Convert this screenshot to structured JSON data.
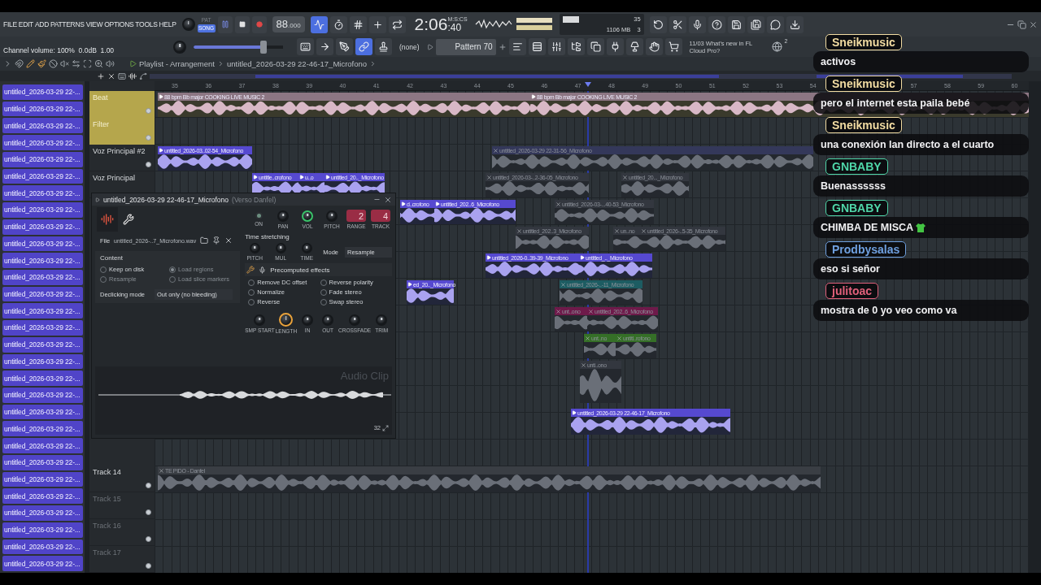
{
  "menu": [
    "FILE",
    "EDIT",
    "ADD",
    "PATTERNS",
    "VIEW",
    "OPTIONS",
    "TOOLS",
    "HELP"
  ],
  "hint_bar": "Channel volume: 100%  0.0dB  1.00",
  "mode_toggle": [
    {
      "label": "PAT",
      "selected": false
    },
    {
      "label": "SONG",
      "selected": true
    }
  ],
  "tempo": {
    "value": "88",
    "decimals": ".000"
  },
  "snap_toggles": [
    {
      "selected": true
    },
    {
      "selected": false
    },
    {
      "selected": false
    },
    {
      "selected": false
    },
    {
      "selected": false
    }
  ],
  "time": {
    "value": "2:06",
    "small": ":40",
    "unit": "M:S:CS"
  },
  "cpu": {
    "value": "35",
    "memory": "1106 MB",
    "polyphony": "3"
  },
  "master_slider": {
    "level": 0.82
  },
  "tool_toggles": [
    {
      "selected": false
    },
    {
      "selected": false
    },
    {
      "selected": false
    },
    {
      "selected": true
    },
    {
      "selected": false
    }
  ],
  "pattern_target": "(none)",
  "pattern": "Pattern 70",
  "news": {
    "date": "11/03",
    "text": "What's new in FL Cloud Pro?",
    "count": "2"
  },
  "playlist": {
    "title": "Playlist - Arrangement",
    "path": "untitled_2026-03-29 22-46-17_Microfono",
    "ruler": [
      [
        "35",
        "36",
        "37",
        "38",
        "39",
        "40",
        "41",
        "42",
        "43",
        "44",
        "45",
        "46",
        "47",
        "48",
        "49",
        "50",
        "51",
        "52",
        "53",
        "54"
      ],
      [
        "57",
        "58",
        "59",
        "60"
      ]
    ],
    "tracks_top": [
      {
        "name": "Beat",
        "color": "#b5a64c",
        "active": true
      },
      {
        "name": "Filter",
        "color": "#b5a64c",
        "active": true
      },
      {
        "name": "Voz Principal #2",
        "active": true
      },
      {
        "name": "Voz Principal"
      }
    ],
    "tracks_bottom": [
      {
        "name": "Track 14",
        "dimmed": false,
        "active": true
      },
      {
        "name": "Track 15",
        "dimmed": true,
        "active": true
      },
      {
        "name": "Track 16",
        "dimmed": true,
        "active": true
      },
      {
        "name": "Track 17",
        "dimmed": true,
        "active": true
      }
    ],
    "clips": [
      {
        "label": "88 bpm Bb major COOKING LIVE MUSIC 2",
        "color": "#8c7683",
        "muted": false
      },
      {
        "label": "88 bpm Bb major COOKING LIVE MUSIC 2",
        "color": "#8c7683",
        "muted": false
      },
      {
        "label": "untitled_2026-03..02-54_Microfono",
        "color": "#5649d0",
        "muted": false
      },
      {
        "label": "untitled_2026-03-29 22-31-56_Microfono",
        "color": "#34385a",
        "muted": true
      },
      {
        "label": "untitle..crofono",
        "color": "#5649d0",
        "muted": false
      },
      {
        "label": "u..o",
        "color": "#5649d0",
        "muted": false
      },
      {
        "label": "untitled_20.._Microfono",
        "color": "#5649d0",
        "muted": false
      },
      {
        "label": "untitled_2026-03-..2-36-05_Microfono",
        "color": "#33373f",
        "muted": true
      },
      {
        "label": "untitled_20..._Microfono",
        "color": "#33373f",
        "muted": true
      },
      {
        "label": "d..crofono",
        "color": "#5649d0",
        "muted": false
      },
      {
        "label": "untitled_202..6_Microfono",
        "color": "#5649d0",
        "muted": false
      },
      {
        "label": "untitled_2026-03-...40-53_Microfono",
        "color": "#33373f",
        "muted": true
      },
      {
        "label": "untitled_202..3_Microfono",
        "color": "#33373f",
        "muted": true
      },
      {
        "label": "un..no",
        "color": "#33373f",
        "muted": true
      },
      {
        "label": "untitled_2026-..5-35_Microfono",
        "color": "#33373f",
        "muted": true
      },
      {
        "label": "untitled_2026-0..39-39_Microfono",
        "color": "#5649d0",
        "muted": false
      },
      {
        "label": "untitled_.._Microfono",
        "color": "#5649d0",
        "muted": false
      },
      {
        "label": "ed_20.._Microfono",
        "color": "#5649d0",
        "muted": false
      },
      {
        "label": "untitled_2026-..-11_Microfono",
        "color": "#1d5c62",
        "muted": true
      },
      {
        "label": "unt..ono",
        "color": "#6e1a4a",
        "muted": true
      },
      {
        "label": "untitled_202..6_Microfono",
        "color": "#6e1a4a",
        "muted": true
      },
      {
        "label": "unt..no",
        "color": "#356f27",
        "muted": true
      },
      {
        "label": "untitl..rofono",
        "color": "#356f27",
        "muted": true
      },
      {
        "label": "unti..ono",
        "color": "#33373f",
        "muted": true
      },
      {
        "label": "untitled_2026-03-29 22-46-17_Microfono",
        "color": "#5649d0",
        "muted": false
      },
      {
        "label": "TE PIDO - Danfel",
        "color": "#3a3e44",
        "muted": true
      }
    ]
  },
  "picker": [
    "untitled_2026-03-29 22-...",
    "untitled_2026-03-29 22-...",
    "untitled_2026-03-29 22-...",
    "untitled_2026-03-29 22-...",
    "untitled_2026-03-29 22-...",
    "untitled_2026-03-29 22-...",
    "untitled_2026-03-29 22-...",
    "untitled_2026-03-29 22-...",
    "untitled_2026-03-29 22-...",
    "untitled_2026-03-29 22-...",
    "untitled_2026-03-29 22-...",
    "untitled_2026-03-29 22-...",
    "untitled_2026-03-29 22-...",
    "untitled_2026-03-29 22-...",
    "untitled_2026-03-29 22-...",
    "untitled_2026-03-29 22-...",
    "untitled_2026-03-29 22-...",
    "untitled_2026-03-29 22-...",
    "untitled_2026-03-29 22-...",
    "untitled_2026-03-29 22-...",
    "untitled_2026-03-29 22-...",
    "untitled_2026-03-29 22-...",
    "untitled_2026-03-29 22-...",
    "untitled_2026-03-29 22-...",
    "untitled_2026-03-29 22-...",
    "untitled_2026-03-29 22-...",
    "untitled_2026-03-29 22-...",
    "untitled_2026-03-29 22-...",
    "untitled_2026-03-29 22-..."
  ],
  "channel_window": {
    "title": "untitled_2026-03-29 22-46-17_Microfono",
    "subtitle": "(Verso Danfel)",
    "controls": [
      {
        "label": "ON",
        "kind": "led"
      },
      {
        "label": "PAN",
        "kind": "knob"
      },
      {
        "label": "VOL",
        "kind": "knob",
        "color": "#39c46a"
      },
      {
        "label": "PITCH",
        "kind": "knob"
      },
      {
        "label": "RANGE",
        "kind": "value",
        "value": "2"
      },
      {
        "label": "TRACK",
        "kind": "value",
        "value": "4"
      }
    ],
    "file_label": "File",
    "file": "untitled_2026-..7_Microfono.wav",
    "content": {
      "title": "Content",
      "options": [
        {
          "label": "Keep on disk",
          "checked": false,
          "disabled": false
        },
        {
          "label": "Load regions",
          "checked": true,
          "disabled": true
        },
        {
          "label": "Resample",
          "checked": false,
          "disabled": true
        },
        {
          "label": "Load slice markers",
          "checked": false,
          "disabled": true
        }
      ]
    },
    "declicking": {
      "label": "Declicking mode",
      "value": "Out only (no bleeding)"
    },
    "time_stretching": {
      "title": "Time stretching",
      "knobs": [
        "PITCH",
        "MUL",
        "TIME"
      ],
      "mode_label": "Mode",
      "mode": "Resample"
    },
    "effects": {
      "title": "Precomputed effects",
      "options": [
        {
          "label": "Remove DC offset",
          "checked": false
        },
        {
          "label": "Reverse polarity",
          "checked": false
        },
        {
          "label": "Normalize",
          "checked": false
        },
        {
          "label": "Fade stereo",
          "checked": false
        },
        {
          "label": "Reverse",
          "checked": false
        },
        {
          "label": "Swap stereo",
          "checked": false
        }
      ]
    },
    "knobs": [
      {
        "label": "SMP START"
      },
      {
        "label": "LENGTH",
        "color": "#e9a23b"
      },
      {
        "label": "IN"
      },
      {
        "label": "OUT"
      },
      {
        "label": "CROSSFADE"
      },
      {
        "label": "TRIM"
      }
    ],
    "caption": "Audio Clip",
    "zoom": "32"
  },
  "chat": [
    {
      "user": "Sneikmusic",
      "color": "#f2dca2",
      "text": "activos",
      "emote": false
    },
    {
      "user": "Sneikmusic",
      "color": "#f2dca2",
      "text": "pero el internet esta paila bebé",
      "emote": false
    },
    {
      "user": "Sneikmusic",
      "color": "#f2dca2",
      "text": "una conexión lan directo a el cuarto",
      "emote": false
    },
    {
      "user": "GNBABY",
      "color": "#4fd6a8",
      "text": "Buenassssss",
      "emote": false
    },
    {
      "user": "GNBABY",
      "color": "#4fd6a8",
      "text": "CHIMBA DE MISCA",
      "emote": true
    },
    {
      "user": "Prodbysalas",
      "color": "#6fa0e0",
      "text": "eso si señor",
      "emote": false
    },
    {
      "user": "julitoac",
      "color": "#e0607a",
      "text": "mostra de 0 yo veo como va",
      "emote": false
    }
  ]
}
